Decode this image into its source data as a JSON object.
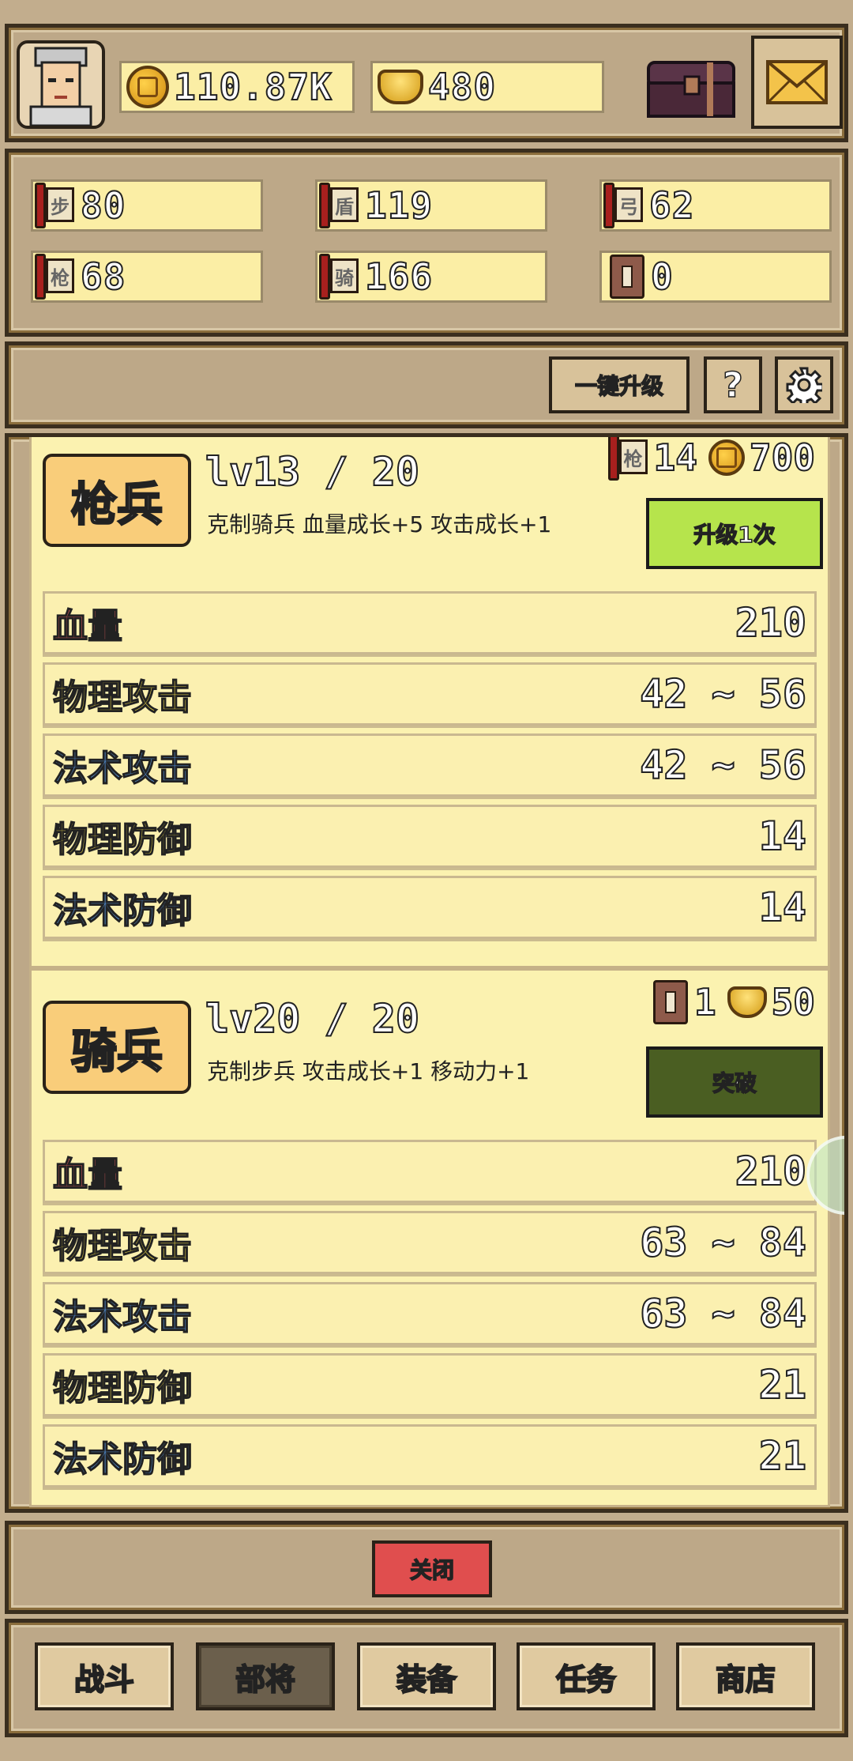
{
  "header": {
    "gold": "110.87K",
    "ingots": "480"
  },
  "resources": [
    {
      "icon": "infantry-token-icon",
      "char": "步",
      "value": "80"
    },
    {
      "icon": "shield-token-icon",
      "char": "盾",
      "value": "119"
    },
    {
      "icon": "archer-token-icon",
      "char": "弓",
      "value": "62"
    },
    {
      "icon": "spear-token-icon",
      "char": "枪",
      "value": "68"
    },
    {
      "icon": "cavalry-token-icon",
      "char": "骑",
      "value": "166"
    },
    {
      "icon": "book-icon",
      "char": "",
      "value": "0"
    }
  ],
  "toolbar": {
    "one_click_upgrade": "一键升级",
    "help": "?",
    "settings_icon": "gear-icon"
  },
  "units": [
    {
      "name": "枪兵",
      "level": "lv13 / 20",
      "desc": "克制骑兵 血量成长+5 攻击成长+1",
      "cost": [
        {
          "icon": "spear-token-icon",
          "char": "枪",
          "value": "14"
        },
        {
          "icon": "coin-icon",
          "value": "700"
        }
      ],
      "action": "升级1次",
      "stats": [
        {
          "label": "血量",
          "value": "210"
        },
        {
          "label": "物理攻击",
          "value": "42 ~ 56"
        },
        {
          "label": "法术攻击",
          "value": "42 ~ 56"
        },
        {
          "label": "物理防御",
          "value": "14"
        },
        {
          "label": "法术防御",
          "value": "14"
        }
      ]
    },
    {
      "name": "骑兵",
      "level": "lv20 / 20",
      "desc": "克制步兵 攻击成长+1 移动力+1",
      "cost": [
        {
          "icon": "book-icon",
          "value": "1"
        },
        {
          "icon": "ingot-icon",
          "value": "50"
        }
      ],
      "action": "突破",
      "stats": [
        {
          "label": "血量",
          "value": "210"
        },
        {
          "label": "物理攻击",
          "value": "63 ~ 84"
        },
        {
          "label": "法术攻击",
          "value": "63 ~ 84"
        },
        {
          "label": "物理防御",
          "value": "21"
        },
        {
          "label": "法术防御",
          "value": "21"
        }
      ]
    }
  ],
  "close_label": "关闭",
  "nav": [
    "战斗",
    "部将",
    "装备",
    "任务",
    "商店"
  ],
  "colors": {
    "upgrade_btn": "#b6e44c",
    "breakthrough_btn": "#4a5e22",
    "close_btn": "#e04e4e",
    "nav_active": "#6b5f4c"
  }
}
